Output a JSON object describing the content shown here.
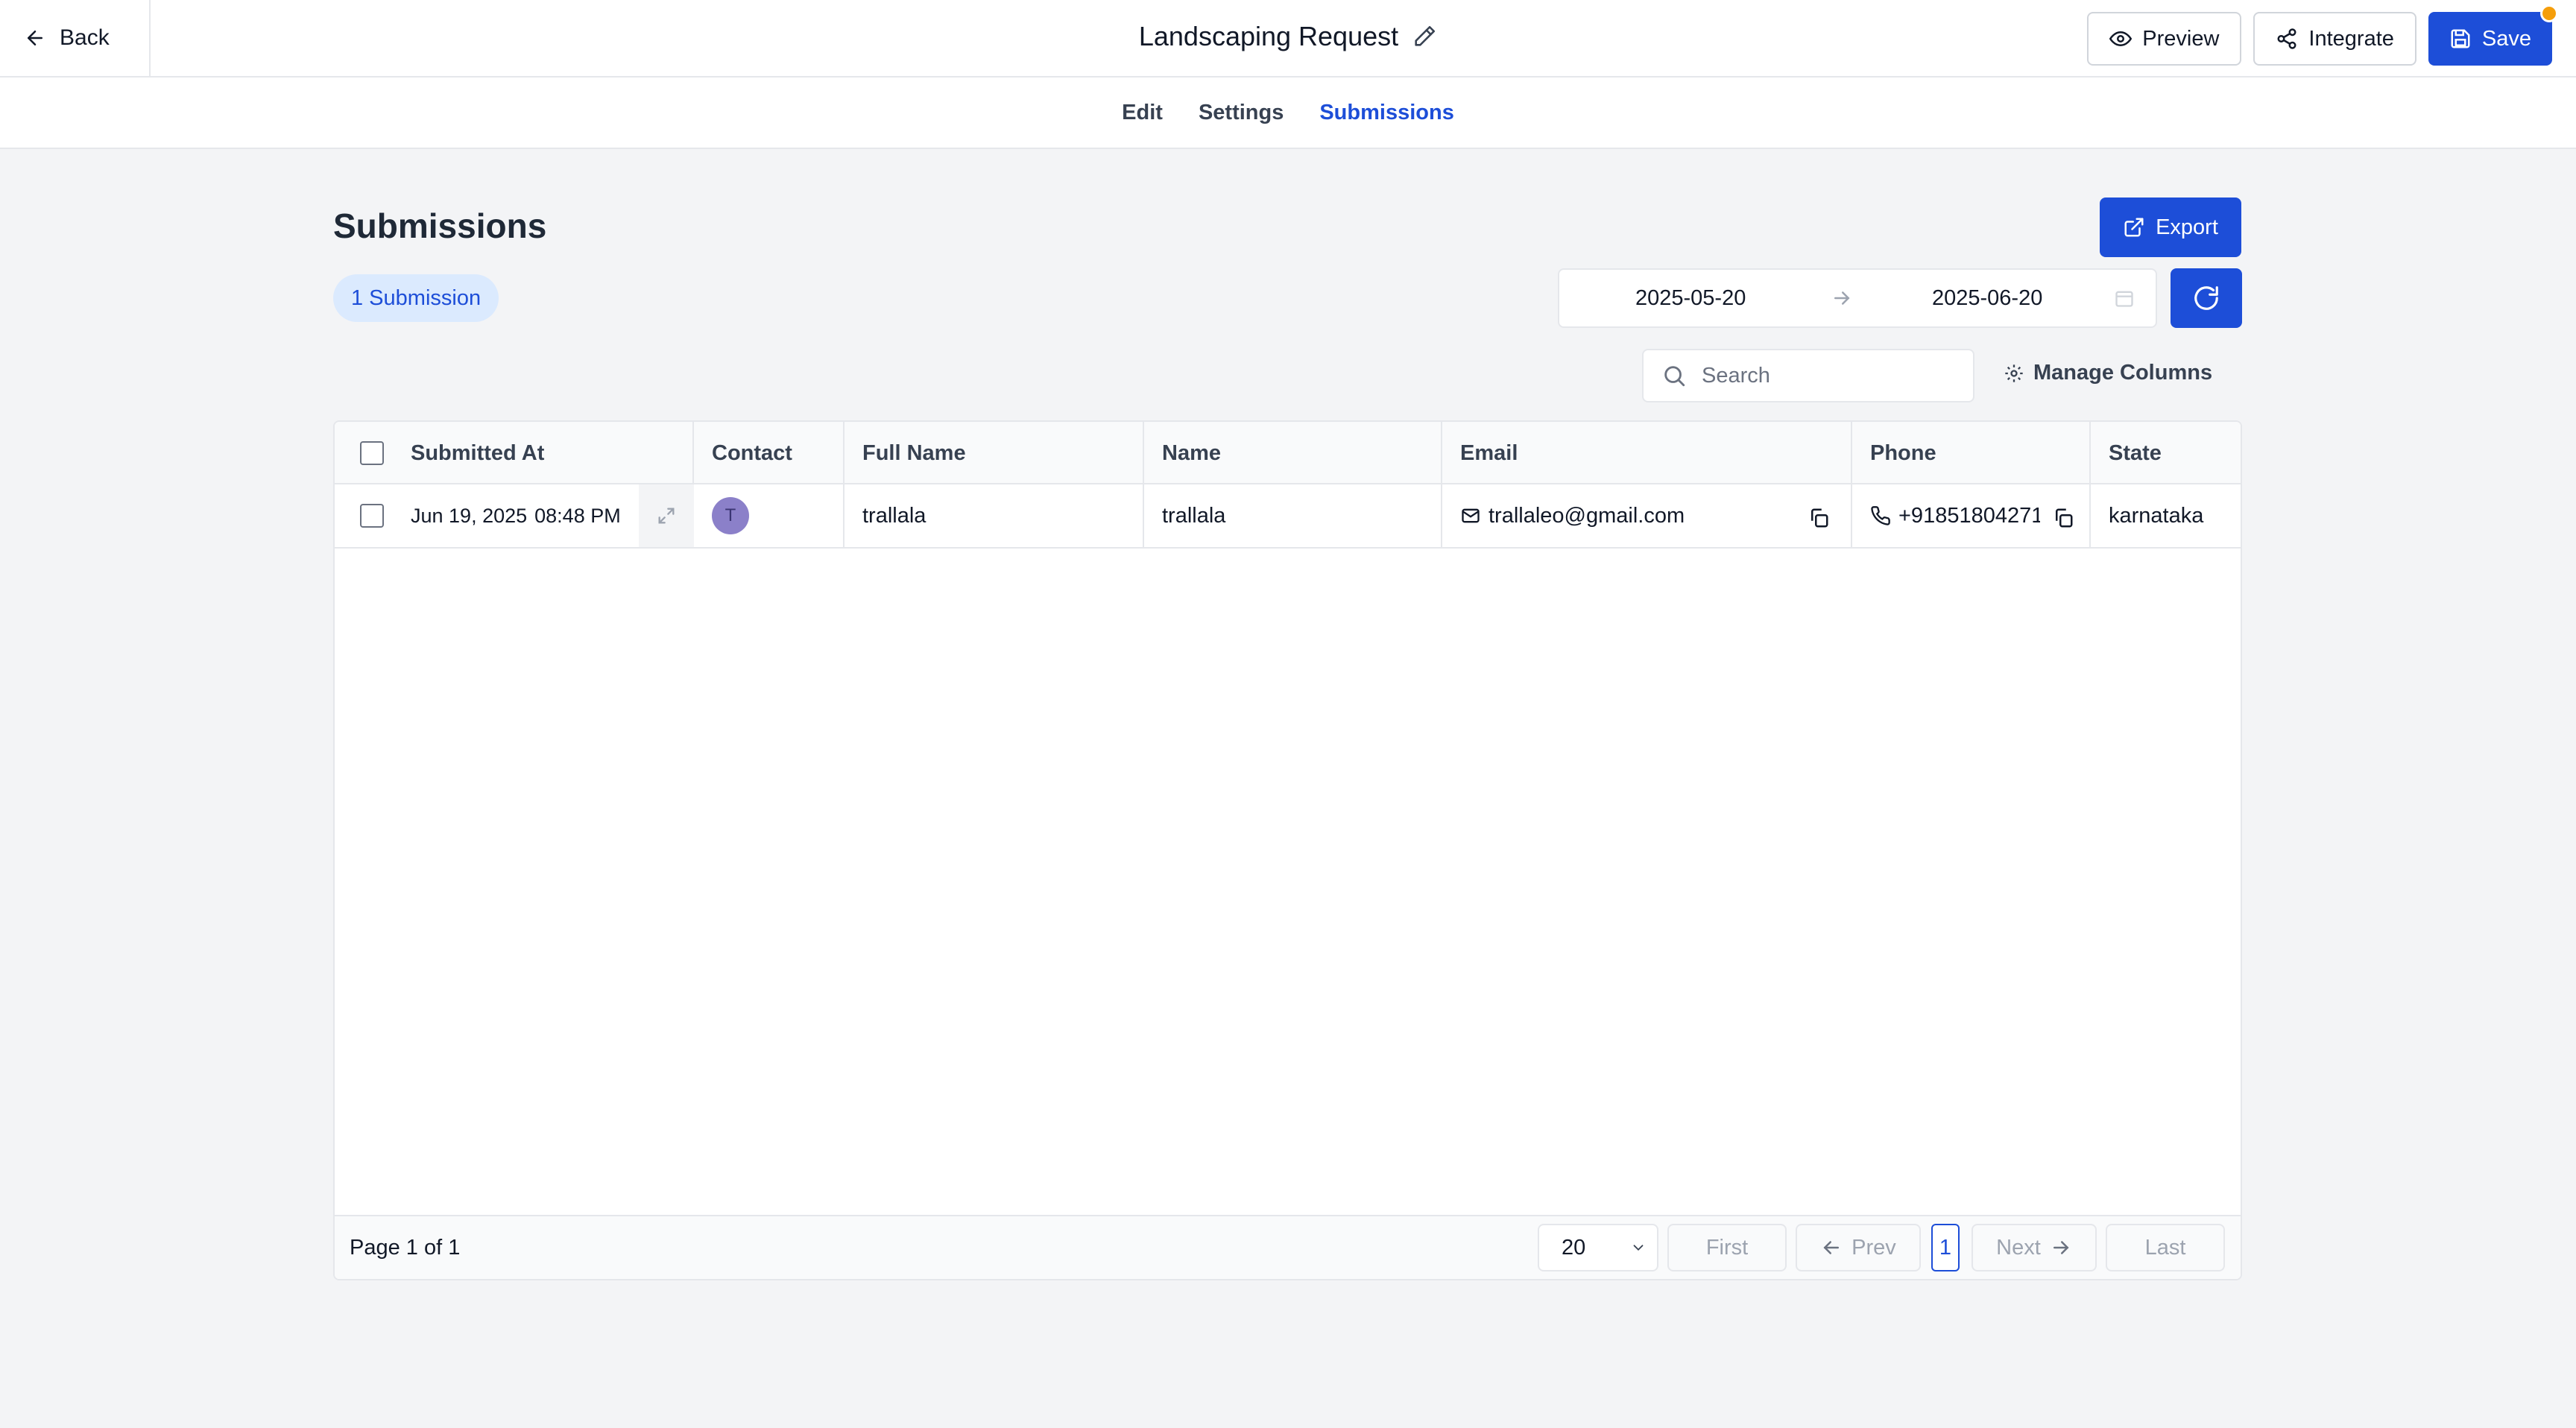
{
  "header": {
    "back_label": "Back",
    "form_title": "Landscaping Request",
    "preview_label": "Preview",
    "integrate_label": "Integrate",
    "save_label": "Save"
  },
  "tabs": [
    {
      "label": "Edit",
      "active": false
    },
    {
      "label": "Settings",
      "active": false
    },
    {
      "label": "Submissions",
      "active": true
    }
  ],
  "main": {
    "title": "Submissions",
    "count_badge": "1 Submission",
    "export_label": "Export",
    "date_from": "2025-05-20",
    "date_to": "2025-06-20",
    "search_placeholder": "Search",
    "manage_columns_label": "Manage Columns"
  },
  "table": {
    "columns": [
      "Submitted At",
      "Contact",
      "Full Name",
      "Name",
      "Email",
      "Phone",
      "State"
    ],
    "rows": [
      {
        "submitted_at": "Jun 19, 2025",
        "submitted_time": "08:48 PM",
        "contact_initial": "T",
        "full_name": "trallala",
        "name": "trallala",
        "email": "trallaleo@gmail.com",
        "phone": "+91851804271",
        "state": "karnataka"
      }
    ]
  },
  "pagination": {
    "page_info": "Page 1 of 1",
    "page_size": "20",
    "first_label": "First",
    "prev_label": "Prev",
    "current_page": "1",
    "next_label": "Next",
    "last_label": "Last"
  },
  "colors": {
    "primary": "#1d4ed8",
    "badge_bg": "#dbeafe",
    "unsaved_dot": "#f59e0b",
    "avatar": "#8b80c9"
  }
}
